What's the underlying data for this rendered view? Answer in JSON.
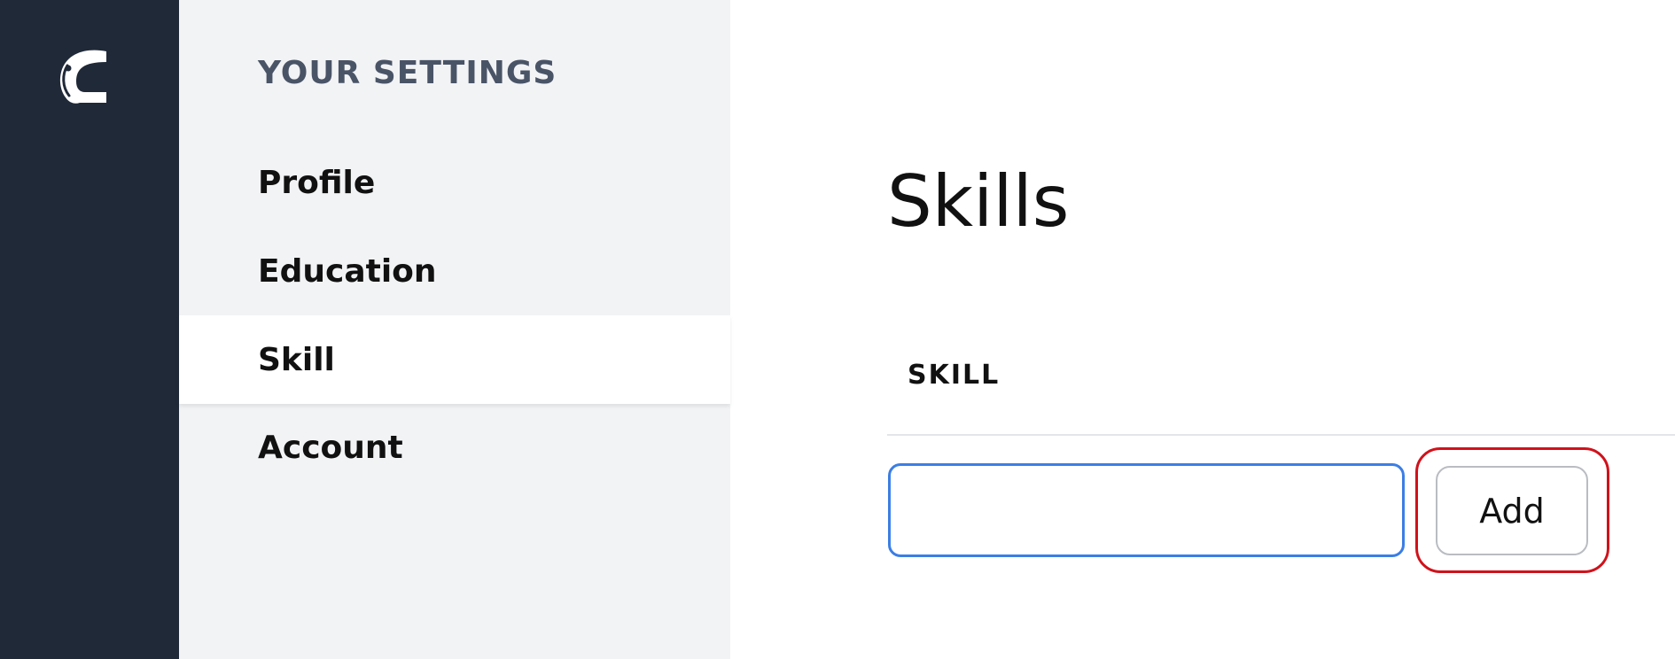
{
  "app": {
    "logo_icon": "c-brand-logo-icon",
    "colors": {
      "rail_bg": "#202938",
      "nav_bg": "#f2f3f5",
      "input_focus": "#3b7ee5",
      "highlight": "#d0121b"
    }
  },
  "sidebar": {
    "heading": "YOUR SETTINGS",
    "items": [
      {
        "label": "Profile",
        "active": false
      },
      {
        "label": "Education",
        "active": false
      },
      {
        "label": "Skill",
        "active": true
      },
      {
        "label": "Account",
        "active": false
      }
    ]
  },
  "main": {
    "title": "Skills",
    "table": {
      "column_header": "SKILL"
    },
    "input": {
      "value": "",
      "placeholder": ""
    },
    "add_button_label": "Add"
  }
}
